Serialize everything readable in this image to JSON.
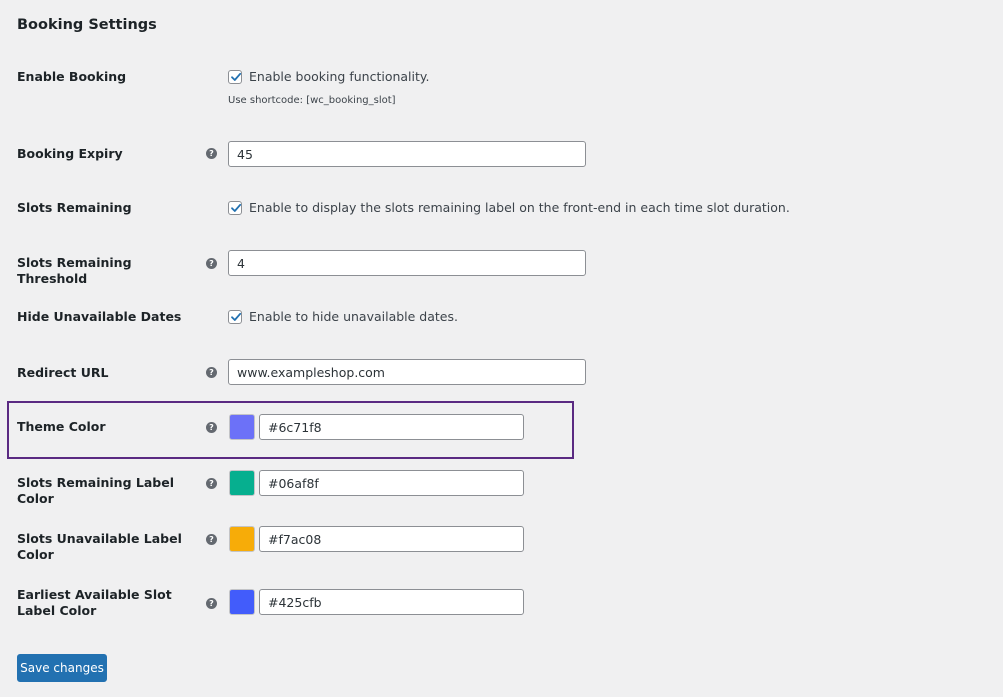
{
  "section": {
    "title": "Booking Settings"
  },
  "fields": {
    "enable_booking": {
      "label": "Enable Booking",
      "checked": true,
      "checkbox_label": "Enable booking functionality.",
      "hint": "Use shortcode: [wc_booking_slot]"
    },
    "booking_expiry": {
      "label": "Booking Expiry",
      "help": "?",
      "value": "45"
    },
    "slots_remaining": {
      "label": "Slots Remaining",
      "checked": true,
      "checkbox_label": "Enable to display the slots remaining label on the front-end in each time slot duration."
    },
    "slots_remaining_threshold": {
      "label": "Slots Remaining Threshold",
      "help": "?",
      "value": "4"
    },
    "hide_unavailable_dates": {
      "label": "Hide Unavailable Dates",
      "checked": true,
      "checkbox_label": "Enable to hide unavailable dates."
    },
    "redirect_url": {
      "label": "Redirect URL",
      "help": "?",
      "value": "www.exampleshop.com"
    },
    "theme_color": {
      "label": "Theme Color",
      "help": "?",
      "value": "#6c71f8",
      "swatch": "#6c71f8"
    },
    "slots_remaining_label_color": {
      "label": "Slots Remaining Label Color",
      "help": "?",
      "value": "#06af8f",
      "swatch": "#06af8f"
    },
    "slots_unavailable_label_color": {
      "label": "Slots Unavailable Label Color",
      "help": "?",
      "value": "#f7ac08",
      "swatch": "#f7ac08"
    },
    "earliest_available_slot_label_color": {
      "label": "Earliest Available Slot Label Color",
      "help": "?",
      "value": "#425cfb",
      "swatch": "#425cfb"
    }
  },
  "actions": {
    "save_label": "Save changes"
  },
  "colors": {
    "accent": "#2271b1",
    "highlight": "#5a2a82",
    "checkmark": "#2271b1"
  }
}
